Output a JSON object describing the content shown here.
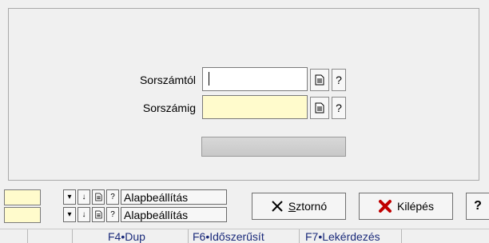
{
  "form": {
    "from_label": "Sorszámtól",
    "to_label": "Sorszámig",
    "from_value": "",
    "to_value": "",
    "help_glyph": "?"
  },
  "defaults": [
    {
      "label": "Alapbeállítás"
    },
    {
      "label": "Alapbeállítás"
    }
  ],
  "buttons": {
    "cancel_prefix": "",
    "cancel_mnemonic": "S",
    "cancel_rest": "ztornó",
    "exit_label": "Kilépés",
    "help_label": "?"
  },
  "statusbar": {
    "items": [
      "F4•Dup",
      "F6•Időszerűsít",
      "F7•Lekérdezés"
    ]
  },
  "colors": {
    "required_field": "#fffbcc",
    "exit_icon": "#c00000",
    "status_text": "#1a2a7a"
  },
  "icons": {
    "lookup": "document-icon",
    "arrow": "arrow-down-icon",
    "cancel": "x-icon",
    "exit": "red-x-icon"
  }
}
